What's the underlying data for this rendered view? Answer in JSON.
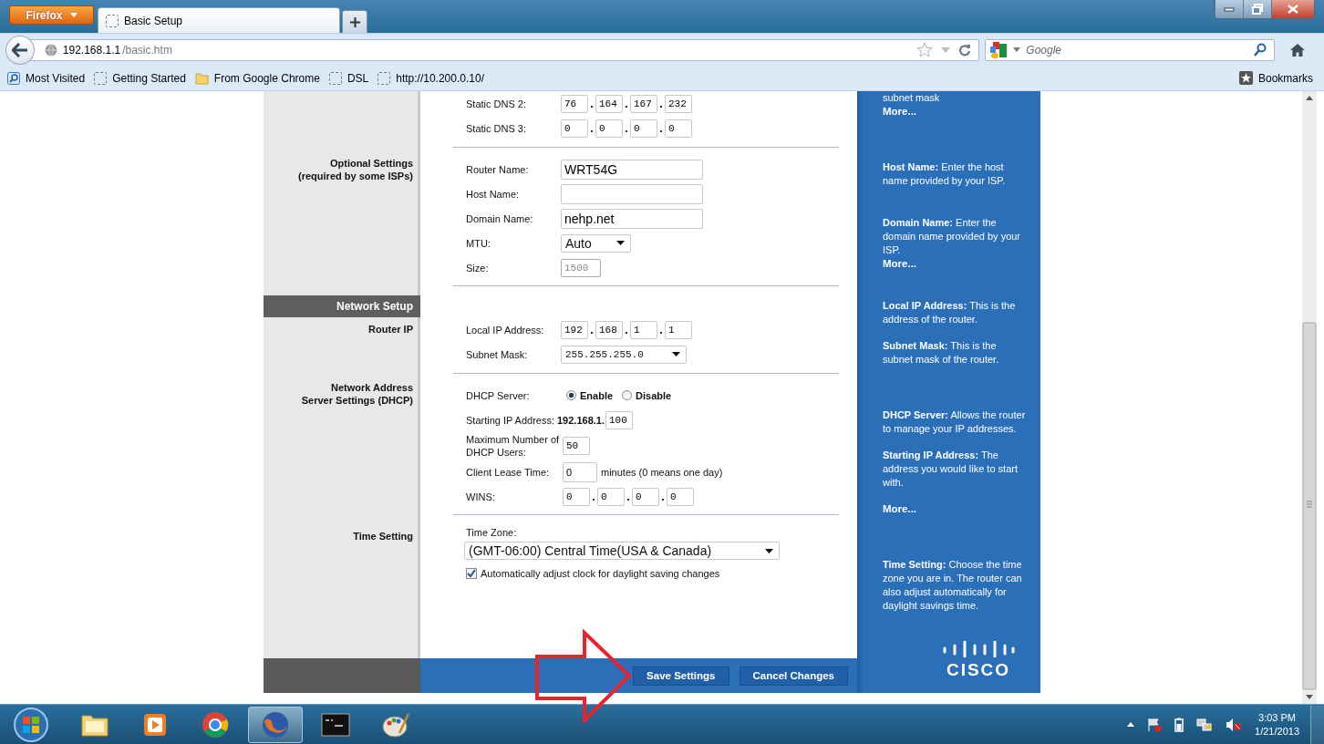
{
  "browser": {
    "menu_button": "Firefox",
    "tabs": [
      {
        "title": "Basic Setup",
        "selected": true
      }
    ],
    "address": {
      "host": "192.168.1.1",
      "path": "/basic.htm"
    },
    "search": {
      "placeholder": "Google"
    },
    "bookmarks": [
      {
        "label": "Most Visited",
        "kind": "special"
      },
      {
        "label": "Getting Started",
        "kind": "page"
      },
      {
        "label": "From Google Chrome",
        "kind": "folder"
      },
      {
        "label": "DSL",
        "kind": "page"
      },
      {
        "label": "http://10.200.0.10/",
        "kind": "page"
      }
    ],
    "bookmarks_menu": "Bookmarks"
  },
  "page": {
    "sections": [
      {
        "rows": [
          {
            "kind": "ip",
            "label": "Static DNS 2:",
            "octets": [
              "76",
              "164",
              "167",
              "232"
            ]
          },
          {
            "kind": "ip",
            "label": "Static DNS 3:",
            "octets": [
              "0",
              "0",
              "0",
              "0"
            ]
          }
        ]
      },
      {
        "label_lines": [
          "Optional Settings",
          "(required by some ISPs)"
        ],
        "rows": [
          {
            "kind": "text",
            "label": "Router Name:",
            "value": "WRT54G"
          },
          {
            "kind": "text",
            "label": "Host Name:"
          },
          {
            "kind": "text",
            "label": "Domain Name:",
            "value": "nehp.net"
          },
          {
            "kind": "select",
            "label": "MTU:",
            "value": "Auto"
          },
          {
            "kind": "readonly",
            "label": "Size:",
            "value": "1500",
            "disabled": true
          }
        ]
      },
      {
        "header": "Network Setup",
        "label_lines": [
          "Router IP"
        ],
        "rows": [
          {
            "kind": "ip",
            "label": "Local IP Address:",
            "octets": [
              "192",
              "168",
              "1",
              "1"
            ]
          },
          {
            "kind": "mono_select",
            "label": "Subnet Mask:",
            "value": "255.255.255.0"
          }
        ]
      },
      {
        "label_lines": [
          "Network Address",
          "Server Settings (DHCP)"
        ],
        "rows": [
          {
            "kind": "radio",
            "label": "DHCP Server:",
            "options": [
              {
                "label": "Enable",
                "selected": true
              },
              {
                "label": "Disable",
                "selected": false
              }
            ]
          },
          {
            "kind": "prefix",
            "label": "Starting IP Address:",
            "prefix": "192.168.1.",
            "value": "100"
          },
          {
            "kind": "small",
            "label": "Maximum Number of DHCP Users:",
            "value": "50"
          },
          {
            "kind": "suffix",
            "label": "Client Lease Time:",
            "value": "0",
            "note": "minutes (0 means one day)"
          },
          {
            "kind": "ip",
            "label": "WINS:",
            "octets": [
              "0",
              "0",
              "0",
              "0"
            ]
          }
        ]
      },
      {
        "label_lines": [
          "Time Setting"
        ],
        "rows": [
          {
            "kind": "wide_select",
            "label": "Time Zone:",
            "value": "(GMT-06:00) Central Time(USA & Canada)"
          },
          {
            "kind": "checkbox",
            "label": "Automatically adjust clock for daylight saving changes",
            "checked": true
          }
        ]
      }
    ],
    "footer_buttons": [
      "Save Settings",
      "Cancel Changes"
    ]
  },
  "help": {
    "groups": [
      {
        "paragraphs": [
          "subnet mask"
        ],
        "more": "More..."
      },
      {
        "paragraphs": [
          "**Host Name:** Enter the host name provided by your ISP."
        ]
      },
      {
        "paragraphs": [
          "**Domain Name:** Enter the domain name provided by your ISP."
        ],
        "more": "More..."
      },
      {
        "paragraphs": [
          "**Local IP Address:** This is the address of the router.",
          "**Subnet Mask:** This is the subnet mask of the router."
        ]
      },
      {
        "paragraphs": [
          "**DHCP Server:** Allows the router to manage your IP addresses.",
          "**Starting IP Address:** The address you would like to start with."
        ],
        "more": "More..."
      },
      {
        "paragraphs": [
          "**Time Setting:** Choose the time zone you are in. The router can also adjust automatically for daylight savings time."
        ]
      }
    ],
    "logo": "CISCO"
  },
  "taskbar": {
    "apps": [
      {
        "kind": "folder",
        "selected": false
      },
      {
        "kind": "player",
        "selected": false
      },
      {
        "kind": "chrome",
        "selected": false
      },
      {
        "kind": "firefox",
        "selected": true
      },
      {
        "kind": "terminal",
        "selected": false
      },
      {
        "kind": "paint",
        "selected": false
      }
    ],
    "clock": {
      "time": "3:03 PM",
      "date": "1/21/2013"
    }
  }
}
